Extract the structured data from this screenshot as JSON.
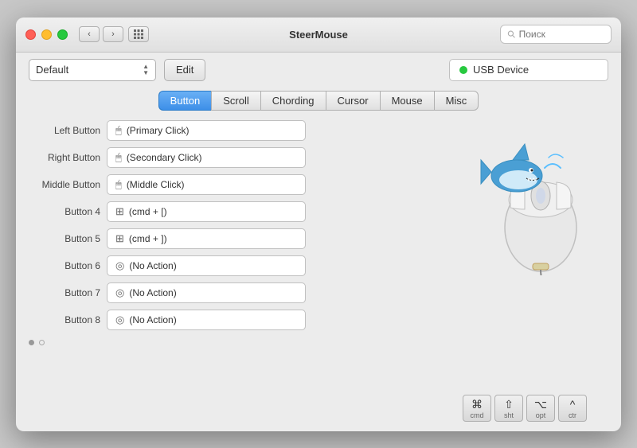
{
  "window": {
    "title": "SteerMouse"
  },
  "titlebar": {
    "search_placeholder": "Поиск"
  },
  "toolbar": {
    "dropdown_value": "Default",
    "edit_label": "Edit",
    "usb_label": "USB Device"
  },
  "tabs": [
    {
      "id": "button",
      "label": "Button",
      "active": true
    },
    {
      "id": "scroll",
      "label": "Scroll",
      "active": false
    },
    {
      "id": "chording",
      "label": "Chording",
      "active": false
    },
    {
      "id": "cursor",
      "label": "Cursor",
      "active": false
    },
    {
      "id": "mouse",
      "label": "Mouse",
      "active": false
    },
    {
      "id": "misc",
      "label": "Misc",
      "active": false
    }
  ],
  "buttons": [
    {
      "label": "Left Button",
      "icon": "🖱",
      "value": "(Primary Click)"
    },
    {
      "label": "Right Button",
      "icon": "🖱",
      "value": "(Secondary Click)"
    },
    {
      "label": "Middle Button",
      "icon": "🖱",
      "value": "(Middle Click)"
    },
    {
      "label": "Button 4",
      "icon": "⊞",
      "value": "(cmd + [)"
    },
    {
      "label": "Button 5",
      "icon": "⊞",
      "value": "(cmd + ])"
    },
    {
      "label": "Button 6",
      "icon": "◎",
      "value": "(No Action)"
    },
    {
      "label": "Button 7",
      "icon": "◎",
      "value": "(No Action)"
    },
    {
      "label": "Button 8",
      "icon": "◎",
      "value": "(No Action)"
    }
  ],
  "modifier_keys": [
    {
      "symbol": "⌘",
      "label": "cmd"
    },
    {
      "symbol": "⇧",
      "label": "sht"
    },
    {
      "symbol": "⌥",
      "label": "opt"
    },
    {
      "symbol": "^",
      "label": "ctr"
    }
  ],
  "pagination": {
    "current": 1,
    "total": 2
  }
}
